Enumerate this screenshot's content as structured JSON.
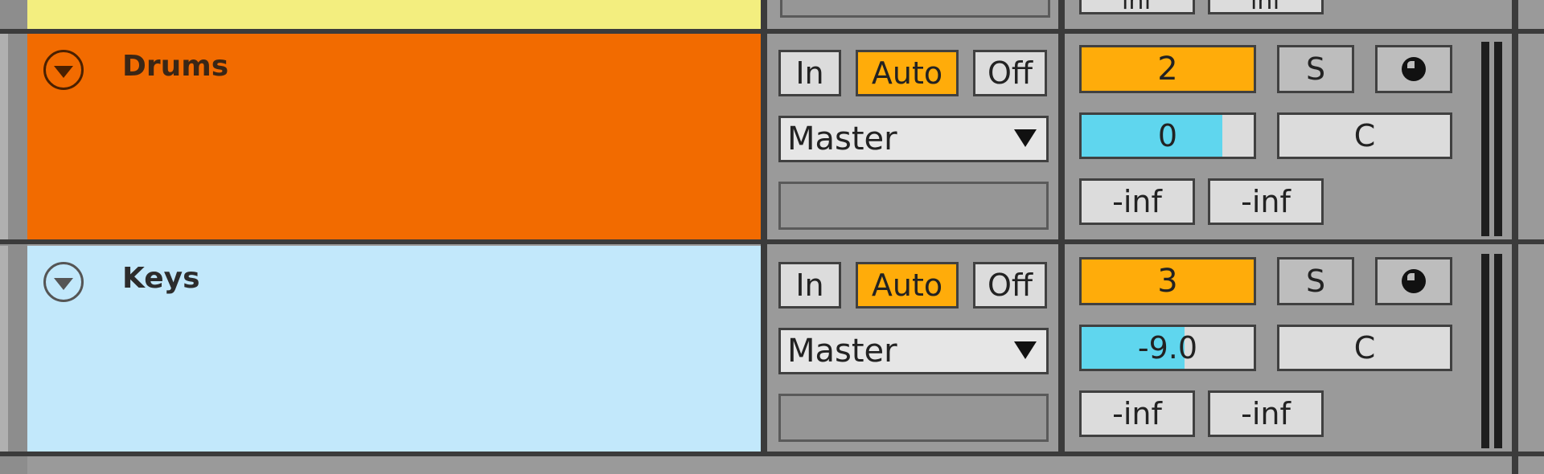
{
  "tracks": [
    {
      "name": "Drums",
      "color": "#f26b00",
      "monitor": {
        "in_label": "In",
        "auto_label": "Auto",
        "off_label": "Off",
        "active": "Auto"
      },
      "output": "Master",
      "track_number": "2",
      "volume": {
        "value": "0",
        "level": 0.82
      },
      "solo_label": "S",
      "pan": "C",
      "peak_left": "-inf",
      "peak_right": "-inf"
    },
    {
      "name": "Keys",
      "color": "#c2e8fb",
      "monitor": {
        "in_label": "In",
        "auto_label": "Auto",
        "off_label": "Off",
        "active": "Auto"
      },
      "output": "Master",
      "track_number": "3",
      "volume": {
        "value": "-9.0",
        "level": 0.6
      },
      "solo_label": "S",
      "pan": "C",
      "peak_left": "-inf",
      "peak_right": "-inf"
    }
  ],
  "previous_track": {
    "color": "#f3ee7f",
    "peak_left": "inf",
    "peak_right": "inf"
  },
  "colors": {
    "accent_orange": "#ffac0a",
    "volume_fill": "#5fd6ee",
    "panel_grey": "#9a9a9a"
  },
  "icons": {
    "fold": "fold-triangle-icon",
    "dropdown": "chevron-down-icon",
    "arm": "record-arm-icon"
  }
}
